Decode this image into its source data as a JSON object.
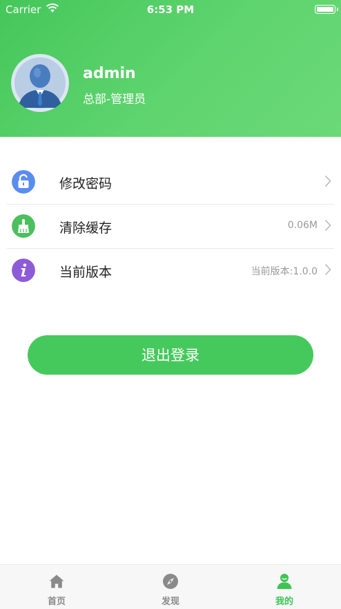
{
  "status_bar": {
    "carrier": "Carrier",
    "time": "6:53 PM"
  },
  "profile": {
    "username": "admin",
    "role": "总部-管理员"
  },
  "menu": {
    "items": [
      {
        "label": "修改密码",
        "value": "",
        "icon": "lock-icon",
        "color": "#5b8def"
      },
      {
        "label": "清除缓存",
        "value": "0.06M",
        "icon": "broom-icon",
        "color": "#4cbf5e"
      },
      {
        "label": "当前版本",
        "value": "当前版本:1.0.0",
        "icon": "info-icon",
        "color": "#8e5bd8"
      }
    ]
  },
  "logout": {
    "label": "退出登录"
  },
  "tabbar": {
    "tabs": [
      {
        "label": "首页",
        "icon": "home-icon",
        "active": false
      },
      {
        "label": "发现",
        "icon": "compass-icon",
        "active": false
      },
      {
        "label": "我的",
        "icon": "person-icon",
        "active": true
      }
    ]
  },
  "colors": {
    "brand": "#46c95c",
    "active_tab": "#3fc455",
    "inactive_tab": "#8a8a8a"
  }
}
